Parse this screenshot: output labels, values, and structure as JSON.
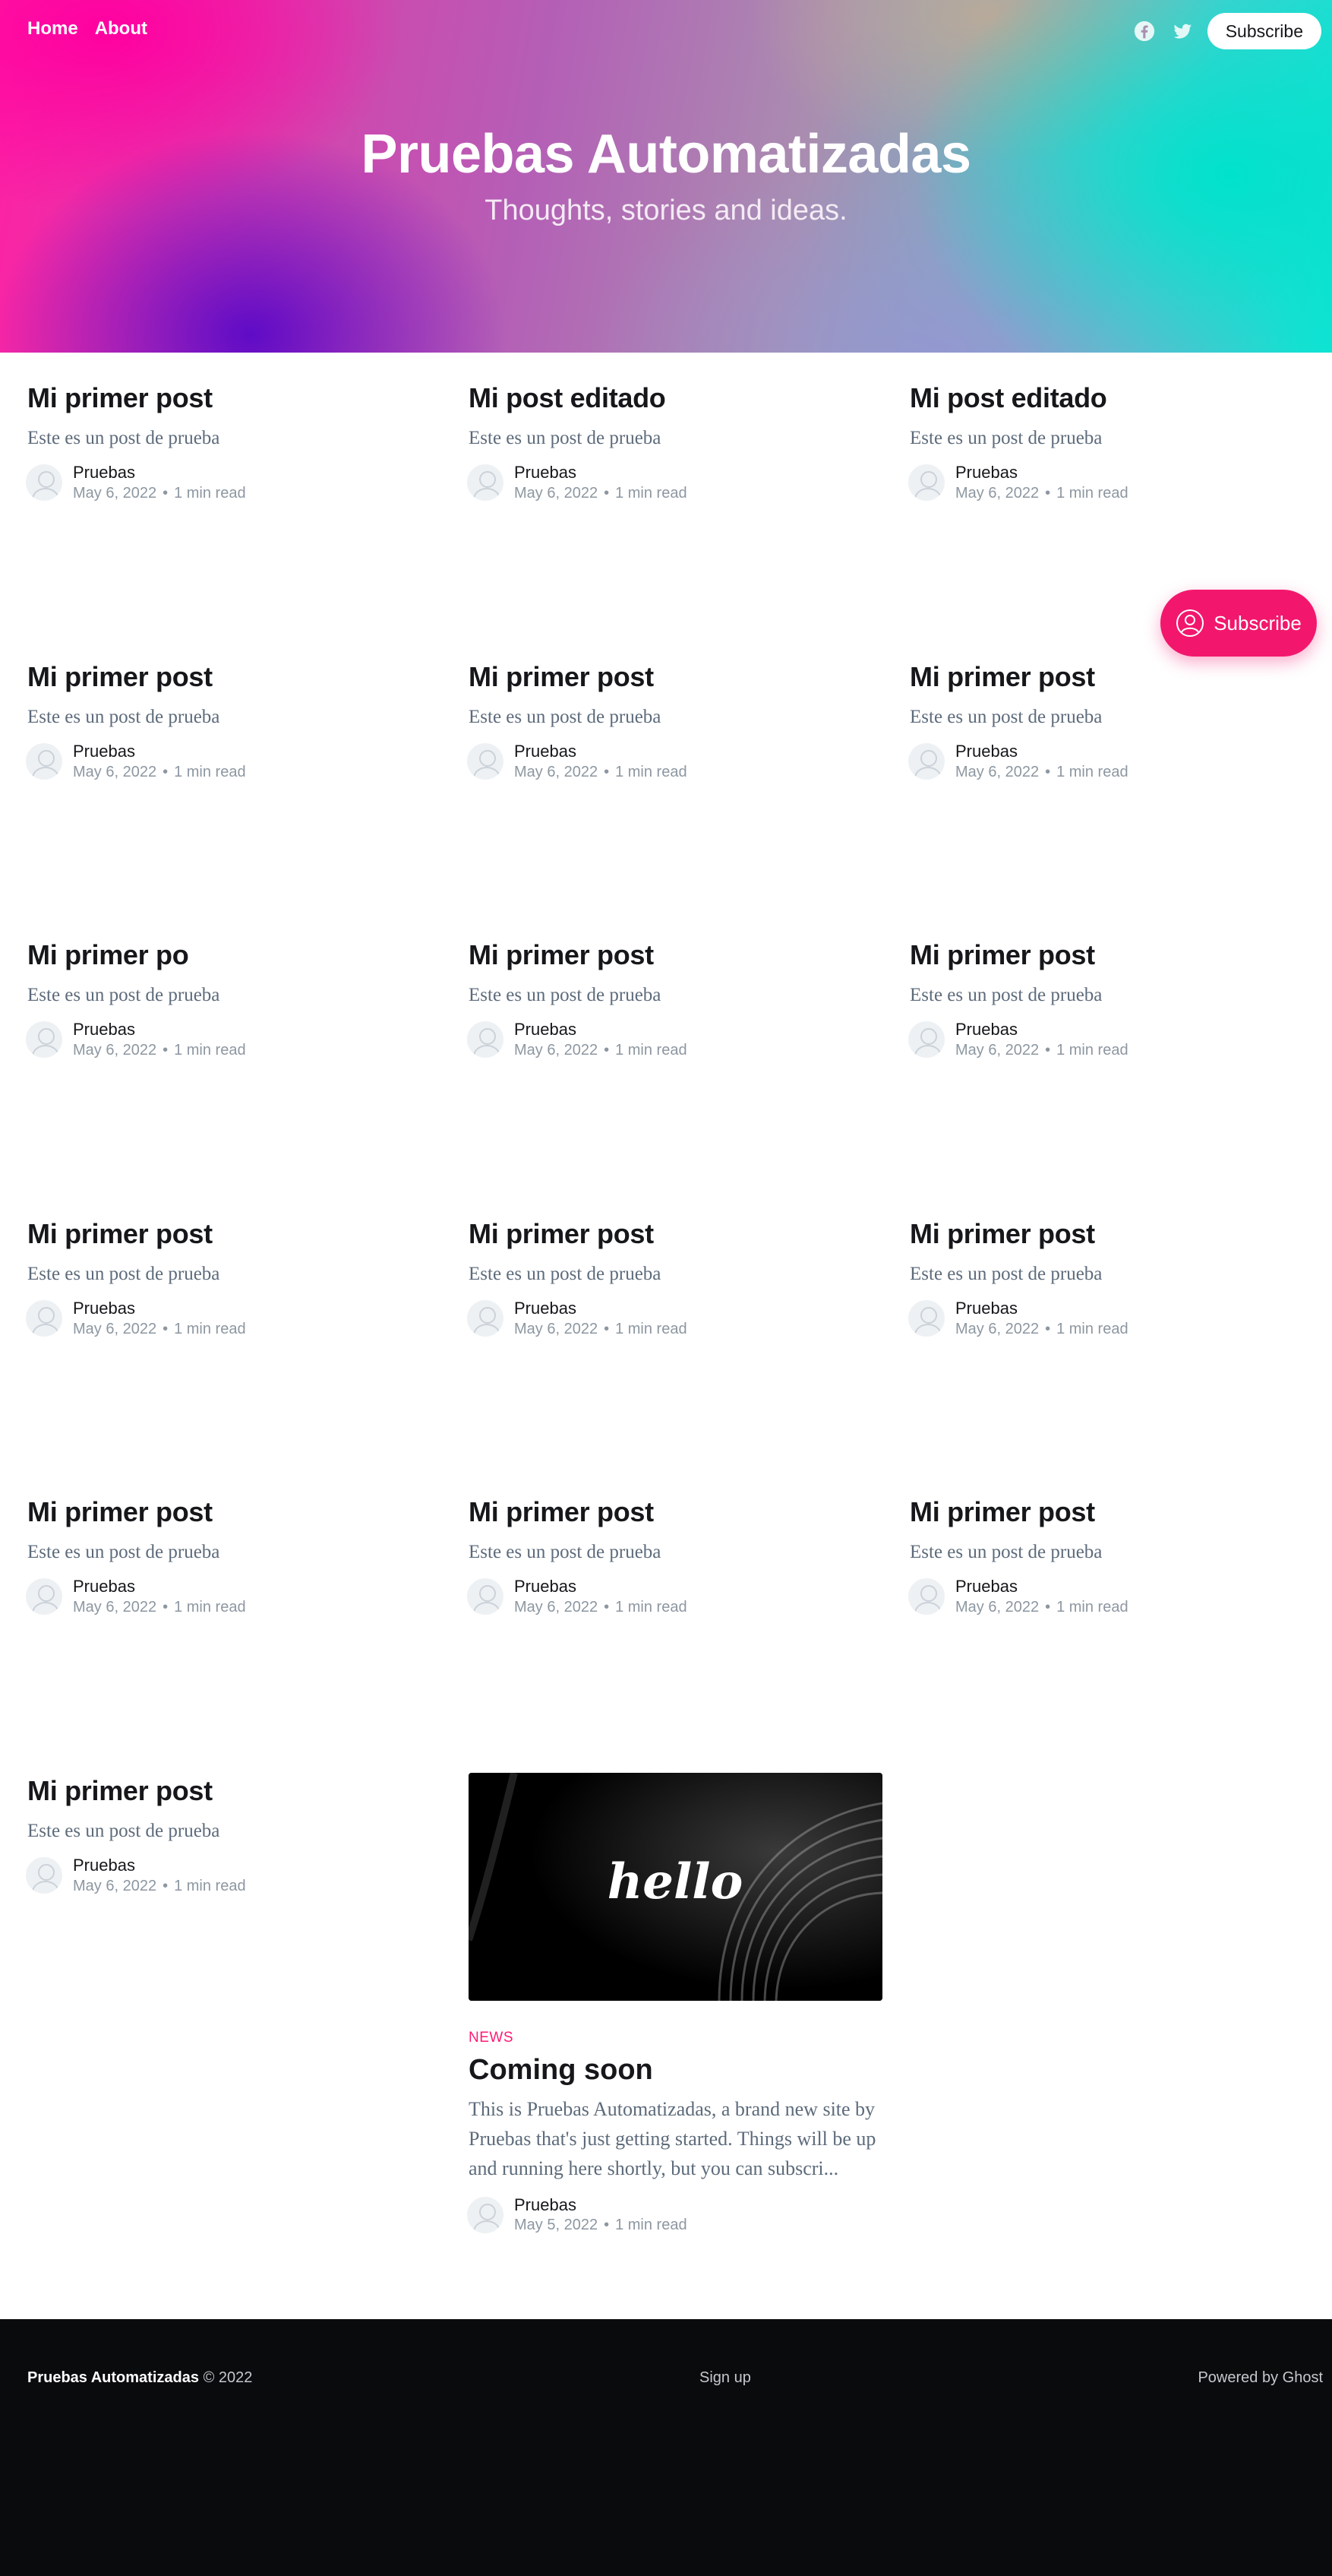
{
  "nav": {
    "links": [
      "Home",
      "About"
    ],
    "subscribe_label": "Subscribe",
    "social_icons": [
      "facebook-icon",
      "twitter-icon"
    ]
  },
  "hero": {
    "title": "Pruebas Automatizadas",
    "description": "Thoughts, stories and ideas."
  },
  "posts": [
    {
      "title": "Mi primer post",
      "excerpt": "Este es un post de prueba",
      "author": "Pruebas",
      "date": "May 6, 2022",
      "read": "1 min read"
    },
    {
      "title": "Mi post editado",
      "excerpt": "Este es un post de prueba",
      "author": "Pruebas",
      "date": "May 6, 2022",
      "read": "1 min read"
    },
    {
      "title": "Mi post editado",
      "excerpt": "Este es un post de prueba",
      "author": "Pruebas",
      "date": "May 6, 2022",
      "read": "1 min read"
    },
    {
      "title": "Mi primer post",
      "excerpt": "Este es un post de prueba",
      "author": "Pruebas",
      "date": "May 6, 2022",
      "read": "1 min read"
    },
    {
      "title": "Mi primer post",
      "excerpt": "Este es un post de prueba",
      "author": "Pruebas",
      "date": "May 6, 2022",
      "read": "1 min read"
    },
    {
      "title": "Mi primer post",
      "excerpt": "Este es un post de prueba",
      "author": "Pruebas",
      "date": "May 6, 2022",
      "read": "1 min read"
    },
    {
      "title": "Mi primer po",
      "excerpt": "Este es un post de prueba",
      "author": "Pruebas",
      "date": "May 6, 2022",
      "read": "1 min read"
    },
    {
      "title": "Mi primer post",
      "excerpt": "Este es un post de prueba",
      "author": "Pruebas",
      "date": "May 6, 2022",
      "read": "1 min read"
    },
    {
      "title": "Mi primer post",
      "excerpt": "Este es un post de prueba",
      "author": "Pruebas",
      "date": "May 6, 2022",
      "read": "1 min read"
    },
    {
      "title": "Mi primer post",
      "excerpt": "Este es un post de prueba",
      "author": "Pruebas",
      "date": "May 6, 2022",
      "read": "1 min read"
    },
    {
      "title": "Mi primer post",
      "excerpt": "Este es un post de prueba",
      "author": "Pruebas",
      "date": "May 6, 2022",
      "read": "1 min read"
    },
    {
      "title": "Mi primer post",
      "excerpt": "Este es un post de prueba",
      "author": "Pruebas",
      "date": "May 6, 2022",
      "read": "1 min read"
    },
    {
      "title": "Mi primer post",
      "excerpt": "Este es un post de prueba",
      "author": "Pruebas",
      "date": "May 6, 2022",
      "read": "1 min read"
    },
    {
      "title": "Mi primer post",
      "excerpt": "Este es un post de prueba",
      "author": "Pruebas",
      "date": "May 6, 2022",
      "read": "1 min read"
    },
    {
      "title": "Mi primer post",
      "excerpt": "Este es un post de prueba",
      "author": "Pruebas",
      "date": "May 6, 2022",
      "read": "1 min read"
    },
    {
      "title": "Mi primer post",
      "excerpt": "Este es un post de prueba",
      "author": "Pruebas",
      "date": "May 6, 2022",
      "read": "1 min read"
    }
  ],
  "feature": {
    "image_text": "hello",
    "tag": "NEWS",
    "title": "Coming soon",
    "excerpt": "This is Pruebas Automatizadas, a brand new site by Pruebas that's just getting started. Things will be up and running here shortly, but you can subscri...",
    "author": "Pruebas",
    "date": "May 5, 2022",
    "read": "1 min read"
  },
  "float_subscribe": {
    "label": "Subscribe",
    "icon": "user-circle-icon"
  },
  "footer": {
    "site": "Pruebas Automatizadas",
    "copyright": "© 2022",
    "signup": "Sign up",
    "powered": "Powered by Ghost"
  },
  "colors": {
    "accent": "#f2176d",
    "footer_bg": "#0a0b0d",
    "excerpt": "#5d6b7b"
  }
}
